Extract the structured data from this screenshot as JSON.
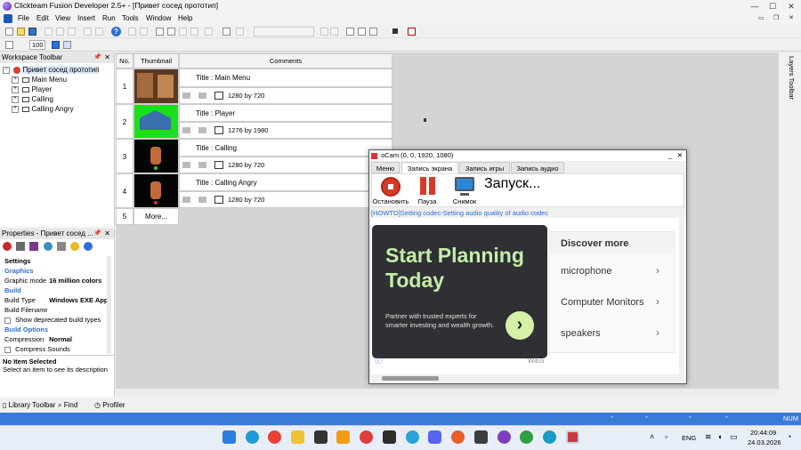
{
  "window": {
    "title": "Clickteam Fusion Developer 2.5+ - [Привет сосед прототип]",
    "controls": [
      "—",
      "☐",
      "✕"
    ],
    "mdi_controls": [
      "▭",
      "❐",
      "✕"
    ]
  },
  "menu": [
    "File",
    "Edit",
    "View",
    "Insert",
    "Run",
    "Tools",
    "Window",
    "Help"
  ],
  "toolbar": {
    "zoom": "100"
  },
  "workspace": {
    "title": "Workspace Toolbar",
    "root": "Привет сосед прототип",
    "items": [
      "Main Menu",
      "Player",
      "Calling",
      "Calling Angry"
    ]
  },
  "storyboard": {
    "headers": {
      "no": "No.",
      "thumbnail": "Thumbnail",
      "comments": "Comments"
    },
    "frames": [
      {
        "no": "1",
        "title": "Title : Main Menu",
        "size": "1280 by  720"
      },
      {
        "no": "2",
        "title": "Title : Player",
        "size": "1276 by 1980"
      },
      {
        "no": "3",
        "title": "Title : Calling",
        "size": "1280 by  720"
      },
      {
        "no": "4",
        "title": "Title : Calling Angry",
        "size": "1280 by  720"
      }
    ],
    "more": {
      "no": "5",
      "label": "More..."
    }
  },
  "properties": {
    "title": "Properties - Привет сосед ...",
    "rows": [
      {
        "label": "Settings",
        "type": "header"
      },
      {
        "label": "Graphics",
        "type": "cat"
      },
      {
        "label": "Graphic mode",
        "value": "16 million colors"
      },
      {
        "label": "Build",
        "type": "cat"
      },
      {
        "label": "Build Type",
        "value": "Windows EXE App"
      },
      {
        "label": "Build Filename",
        "value": ""
      },
      {
        "label": "Show deprecated build types",
        "type": "check"
      },
      {
        "label": "Build Options",
        "type": "cat"
      },
      {
        "label": "Compression",
        "value": "Normal"
      },
      {
        "label": "Compress Sounds",
        "type": "check"
      }
    ],
    "info_title": "No Item Selected",
    "info_desc": "Select an item to see its description"
  },
  "bottom_tabs": [
    "Library Toolbar",
    "Find",
    "Profiler"
  ],
  "status": {
    "num": "NUM"
  },
  "ocam": {
    "title": "oCam (0, 0, 1920, 1080)",
    "tabs": [
      "Меню",
      "Запись экрана",
      "Запись игры",
      "Запись аудио"
    ],
    "buttons": [
      "Остановить",
      "Пауза",
      "Снимок"
    ],
    "status": "Запуск...",
    "link": "[HOWTO]Setting codec-Setting audio quality of audio codec",
    "ad": {
      "headline": "Start Planning Today",
      "subtext": "Partner with trusted experts for smarter investing and wealth growth.",
      "discover_title": "Discover more",
      "discover_items": [
        "microphone",
        "Computer Monitors",
        "speakers"
      ],
      "brand": "Wilco"
    }
  },
  "taskbar": {
    "lang": "ENG",
    "time": "20:44:09",
    "date": "24.03.2026"
  }
}
